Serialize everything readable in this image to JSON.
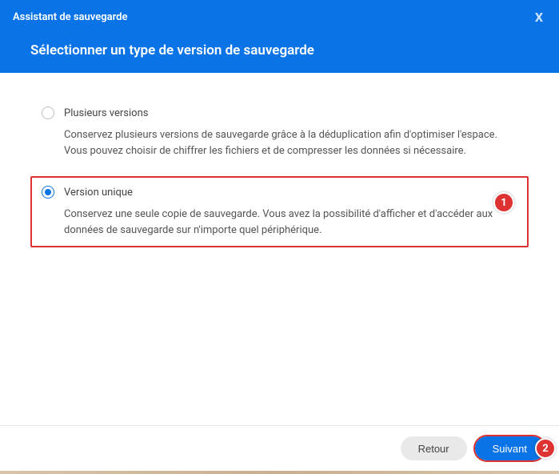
{
  "header": {
    "app_title": "Assistant de sauvegarde",
    "close_label": "X",
    "page_title": "Sélectionner un type de version de sauvegarde"
  },
  "options": {
    "multi": {
      "label": "Plusieurs versions",
      "desc": "Conservez plusieurs versions de sauvegarde grâce à la déduplication afin d'optimiser l'espace. Vous pouvez choisir de chiffrer les fichiers et de compresser les données si nécessaire.",
      "selected": false
    },
    "single": {
      "label": "Version unique",
      "desc": "Conservez une seule copie de sauvegarde. Vous avez la possibilité d'afficher et d'accéder aux données de sauvegarde sur n'importe quel périphérique.",
      "selected": true
    }
  },
  "callouts": {
    "one": "1",
    "two": "2"
  },
  "footer": {
    "back_label": "Retour",
    "next_label": "Suivant"
  },
  "colors": {
    "primary": "#0a74e6",
    "highlight": "#de3232"
  }
}
